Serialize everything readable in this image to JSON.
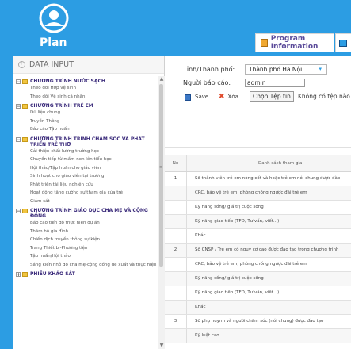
{
  "brand": {
    "logo_text": "Plan"
  },
  "nav": {
    "program_label": "Program Information"
  },
  "left_panel": {
    "title": "DATA INPUT",
    "sections": [
      {
        "title": "CHƯƠNG TRÌNH NƯỚC SẠCH",
        "items": [
          "Theo dõi Hợp vệ sinh",
          "Theo dõi Vệ sinh cá nhân"
        ]
      },
      {
        "title": "CHƯƠNG TRÌNH TRẺ EM",
        "items": [
          "Dữ liệu chung",
          "Truyền Thông",
          "Báo cáo Tập huấn"
        ]
      },
      {
        "title": "CHƯƠNG TRÌNH TRÌNH CHĂM SÓC VÀ PHÁT TRIỂN TRẺ THƠ",
        "items": [
          "Cải thiện chất lượng trường học",
          "Chuyển tiếp từ mầm non lên tiểu học",
          "Hội thảo/Tập huấn cho giáo viên",
          "Sinh hoạt cho giáo viên tại trường",
          "Phát triển tài liệu nghiên cứu",
          "Hoạt động tăng cường sự tham gia của trẻ",
          "Giám sát"
        ]
      },
      {
        "title": "CHƯƠNG TRÌNH GIÁO DỤC CHA MẸ VÀ CỘNG ĐỒNG",
        "items": [
          "Báo cáo tiến độ thực hiện dự án",
          "Thăm hộ gia đình",
          "Chiến dịch truyền thông sự kiện",
          "Trang Thiết bị-Phương tiện",
          "Tập huấn/Hội thảo",
          "Sáng kiến nhỏ do cha mẹ-cộng đồng đề xuất và thực hiện"
        ]
      },
      {
        "title": "PHIẾU KHẢO SÁT",
        "items": []
      }
    ]
  },
  "form": {
    "province_label": "Tỉnh/Thành phố:",
    "province_value": "Thành phố Hà Nội",
    "reporter_label": "Người báo cáo:",
    "reporter_value": "admin",
    "save_label": "Save",
    "delete_label": "Xóa",
    "choose_file_label": "Chọn Tệp tin",
    "no_file_label": "Không có tệp nào được"
  },
  "table": {
    "col_no": "No",
    "col_name": "Danh sách tham gia",
    "rows": [
      {
        "no": "1",
        "name": "Số thành viên trẻ em nòng cốt và hoặc trẻ em nói chung được đào"
      },
      {
        "no": "",
        "name": "CRC, bảo vệ trẻ em, phòng chống ngược đãi trẻ em"
      },
      {
        "no": "",
        "name": "Kỹ năng sống/ giá trị cuộc sống"
      },
      {
        "no": "",
        "name": "Kỹ năng giao tiếp (TFD, Tư vấn, viết...)"
      },
      {
        "no": "",
        "name": "Khác"
      },
      {
        "no": "2",
        "name": "Số CNSP / Trẻ em có nguy cơ cao được đào tạo trong chương trình"
      },
      {
        "no": "",
        "name": "CRC, bảo vệ trẻ em, phòng chống ngược đãi trẻ em"
      },
      {
        "no": "",
        "name": "Kỹ năng sống/ giá trị cuộc sống"
      },
      {
        "no": "",
        "name": "Kỹ năng giao tiếp (TFD, Tư vấn, viết...)"
      },
      {
        "no": "",
        "name": "Khác"
      },
      {
        "no": "3",
        "name": "Số phụ huynh và người chăm sóc (nói chung) được đào tạo"
      },
      {
        "no": "",
        "name": "Kỹ luật cao"
      }
    ]
  }
}
